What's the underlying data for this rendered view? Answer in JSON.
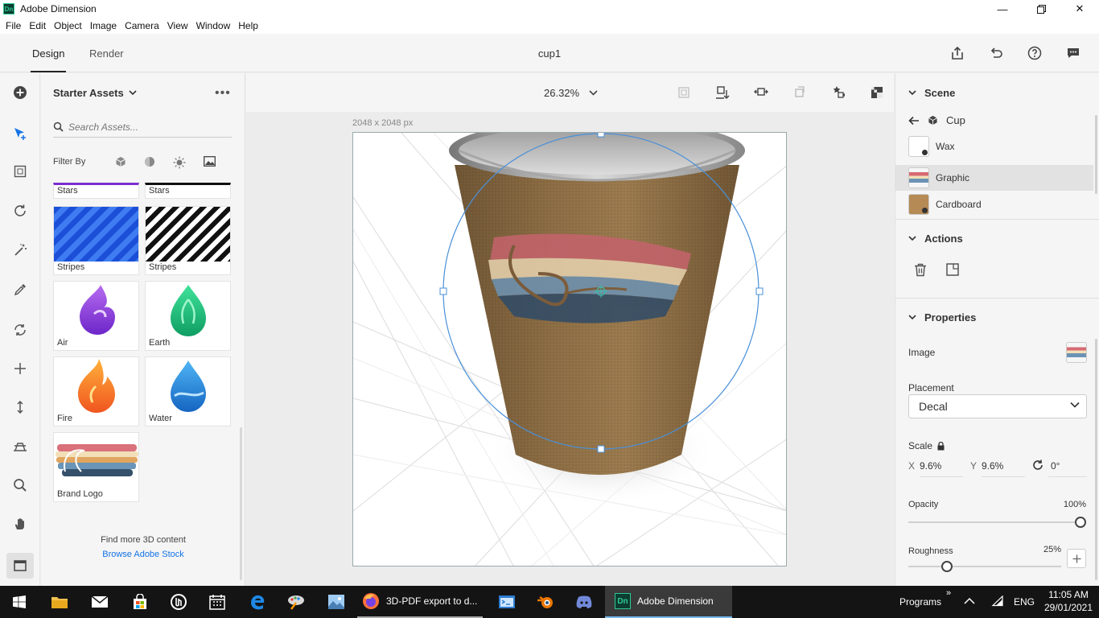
{
  "window": {
    "title": "Adobe Dimension",
    "app_badge": "Dn"
  },
  "menu": [
    "File",
    "Edit",
    "Object",
    "Image",
    "Camera",
    "View",
    "Window",
    "Help"
  ],
  "modes": {
    "design": "Design",
    "render": "Render"
  },
  "document": {
    "name": "cup1"
  },
  "assets": {
    "title": "Starter Assets",
    "search_placeholder": "Search Assets...",
    "filter_label": "Filter By",
    "items": [
      {
        "label": "Stars"
      },
      {
        "label": "Stars"
      },
      {
        "label": "Stripes"
      },
      {
        "label": "Stripes"
      },
      {
        "label": "Air"
      },
      {
        "label": "Earth"
      },
      {
        "label": "Fire"
      },
      {
        "label": "Water"
      },
      {
        "label": "Brand Logo"
      }
    ],
    "find_more": "Find more 3D content",
    "browse_link": "Browse Adobe Stock"
  },
  "canvas": {
    "zoom": "26.32%",
    "size_label": "2048 x 2048 px"
  },
  "scene": {
    "title": "Scene",
    "object": "Cup",
    "layers": [
      {
        "name": "Wax",
        "selected": false
      },
      {
        "name": "Graphic",
        "selected": true
      },
      {
        "name": "Cardboard",
        "selected": false
      }
    ]
  },
  "actions": {
    "title": "Actions"
  },
  "properties": {
    "title": "Properties",
    "image_label": "Image",
    "placement_label": "Placement",
    "placement_value": "Decal",
    "scale_label": "Scale",
    "x_label": "X",
    "x_value": "9.6%",
    "y_label": "Y",
    "y_value": "9.6%",
    "rotation_value": "0°",
    "opacity_label": "Opacity",
    "opacity_value": "100%",
    "opacity_level": 1.0,
    "roughness_label": "Roughness",
    "roughness_value": "25%",
    "roughness_level": 0.25
  },
  "taskbar": {
    "firefox_title": "3D-PDF export to d...",
    "dimension_title": "Adobe Dimension",
    "programs": "Programs",
    "lang": "ENG",
    "time": "11:05 AM",
    "date": "29/01/2021"
  },
  "colors": {
    "accent": "#1473e6",
    "selection": "#4a90d9",
    "taskbar": "#141414"
  }
}
